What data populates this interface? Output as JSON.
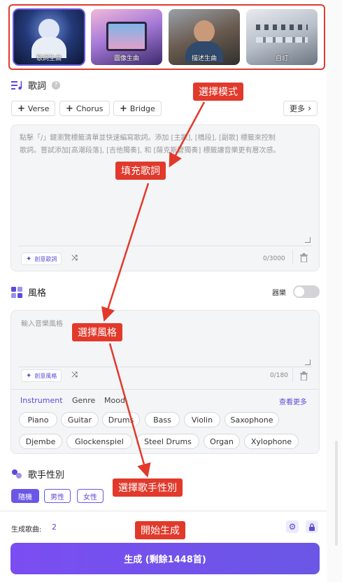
{
  "modes": [
    {
      "label": "歌詞生曲",
      "active": true
    },
    {
      "label": "圖像生曲",
      "active": false
    },
    {
      "label": "描述生曲",
      "active": false
    },
    {
      "label": "自訂",
      "active": false
    }
  ],
  "lyrics": {
    "title": "歌詞",
    "help": "?",
    "chips": [
      "Verse",
      "Chorus",
      "Bridge"
    ],
    "more_label": "更多",
    "placeholder_line1": "點擊「/」鍵瀏覽標籤清單並快速編寫歌詞。添加 [主歌], [橋段], [副歌] 標籤來控制",
    "placeholder_line2": "歌詞。嘗試添加[高潮段落], [吉他獨奏], 和 [薩克斯管獨奏] 標籤讓音樂更有層次感。",
    "ai_label": "創意歌詞",
    "counter": "0/3000"
  },
  "style": {
    "title": "風格",
    "toggle_label": "器樂",
    "placeholder": "輸入音樂風格",
    "ai_label": "創意風格",
    "counter": "0/180",
    "tabs": [
      "Instrument",
      "Genre",
      "Mood"
    ],
    "see_more": "查看更多",
    "tags_row1": [
      "Piano",
      "Guitar",
      "Drums",
      "Bass",
      "Violin",
      "Saxophone"
    ],
    "tags_row2": [
      "Djembe",
      "Glockenspiel",
      "Steel Drums",
      "Organ",
      "Xylophone"
    ]
  },
  "gender": {
    "title": "歌手性別",
    "options": [
      "隨機",
      "男性",
      "女性"
    ],
    "selected": "隨機"
  },
  "footer": {
    "gen_count_label": "生成歌曲:",
    "gen_count": "2",
    "generate_label": "生成 (剩餘1448首)"
  },
  "annotations": {
    "select_mode": "選擇模式",
    "fill_lyrics": "填充歌詞",
    "select_style": "選擇風格",
    "select_gender": "選擇歌手性別",
    "start_generate": "開始生成"
  },
  "colors": {
    "accent": "#5b4bd8",
    "annotation": "#e1392b",
    "button_start": "#7b4df2",
    "button_end": "#6a57e6"
  }
}
